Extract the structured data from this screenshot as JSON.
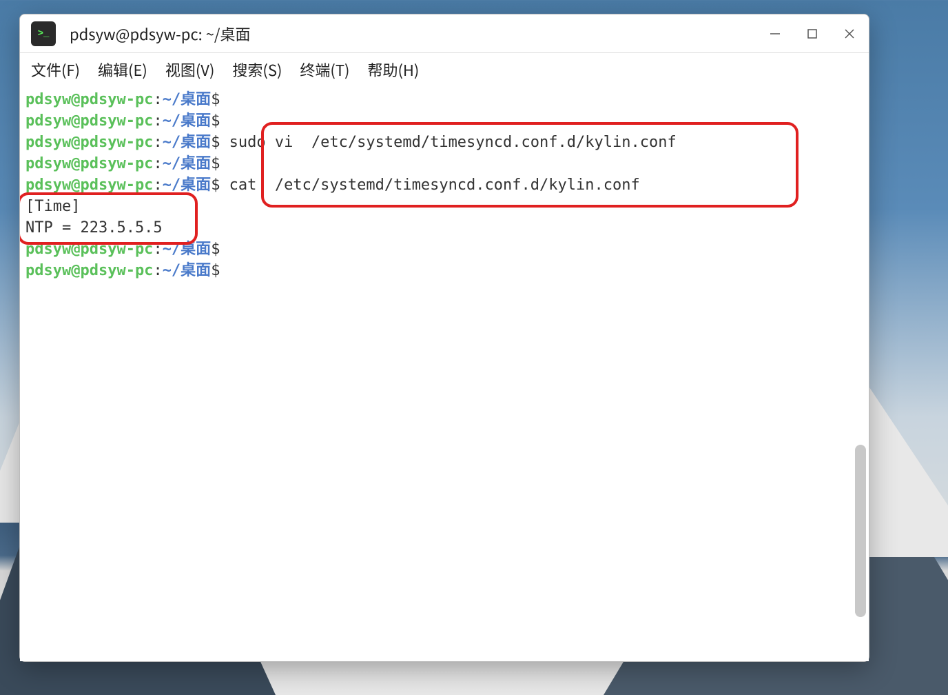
{
  "window": {
    "title": "pdsyw@pdsyw-pc: ~/桌面"
  },
  "menu": {
    "file": "文件(F)",
    "edit": "编辑(E)",
    "view": "视图(V)",
    "search": "搜索(S)",
    "terminal": "终端(T)",
    "help": "帮助(H)"
  },
  "prompt": {
    "user_host": "pdsyw@pdsyw-pc",
    "colon": ":",
    "path": "~/桌面",
    "symbol": "$"
  },
  "lines": {
    "cmd1": " sudo vi  /etc/systemd/timesyncd.conf.d/kylin.conf",
    "cmd2": " cat  /etc/systemd/timesyncd.conf.d/kylin.conf",
    "out1": "[Time]",
    "out2": "NTP = 223.5.5.5"
  },
  "icon": {
    "prompt": ">_"
  }
}
